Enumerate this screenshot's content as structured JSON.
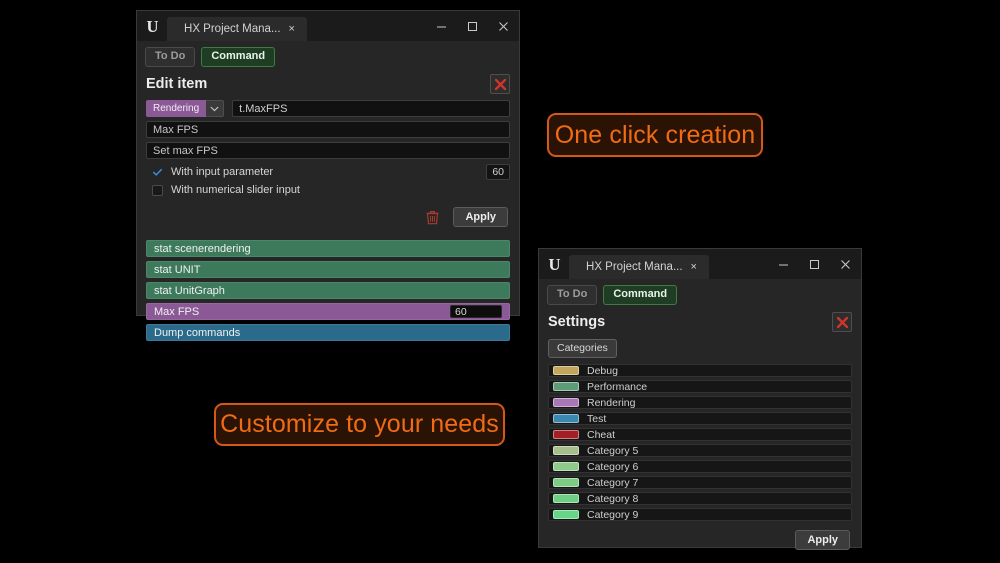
{
  "window_edit": {
    "name": "HX Project Manager - Edit item",
    "titlebar": {
      "tab_label": "HX Project Mana...",
      "tab_close": "×",
      "minimize": "minimize-icon",
      "maximize": "maximize-icon",
      "close": "close-icon"
    },
    "tabs": [
      {
        "label": "To Do",
        "active": false
      },
      {
        "label": "Command",
        "active": true
      }
    ],
    "section_title": "Edit item",
    "close_section": "close-red-icon",
    "category_badge": "Rendering",
    "category_caret": "chevron-down-icon",
    "command_value": "t.MaxFPS",
    "display_name": "Max FPS",
    "description": "Set max FPS",
    "options": [
      {
        "label": "With input parameter",
        "checked": true,
        "value": "60"
      },
      {
        "label": "With numerical slider input",
        "checked": false,
        "value": ""
      }
    ],
    "delete_icon": "trash-icon",
    "apply_label": "Apply",
    "commands": [
      {
        "label": "stat scenerendering",
        "color": "#3d7a5c",
        "value": null
      },
      {
        "label": "stat UNIT",
        "color": "#3d7a5c",
        "value": null
      },
      {
        "label": "stat UnitGraph",
        "color": "#3d7a5c",
        "value": null
      },
      {
        "label": "Max FPS",
        "color": "#8b5a96",
        "value": "60"
      },
      {
        "label": "Dump commands",
        "color": "#2a6b8c",
        "value": null
      }
    ]
  },
  "window_settings": {
    "name": "HX Project Manager - Settings",
    "titlebar": {
      "tab_label": "HX Project Mana...",
      "tab_close": "×",
      "minimize": "minimize-icon",
      "maximize": "maximize-icon",
      "close": "close-icon"
    },
    "tabs": [
      {
        "label": "To Do",
        "active": false
      },
      {
        "label": "Command",
        "active": true
      }
    ],
    "section_title": "Settings",
    "close_section": "close-red-icon",
    "categories_button": "Categories",
    "categories": [
      {
        "label": "Debug",
        "color": "#c2a65c"
      },
      {
        "label": "Performance",
        "color": "#5e9c77"
      },
      {
        "label": "Rendering",
        "color": "#a877b5"
      },
      {
        "label": "Test",
        "color": "#3a87b0"
      },
      {
        "label": "Cheat",
        "color": "#a31f26"
      },
      {
        "label": "Category 5",
        "color": "#a7bd8c"
      },
      {
        "label": "Category 6",
        "color": "#8ecb8a"
      },
      {
        "label": "Category 7",
        "color": "#7ecb86"
      },
      {
        "label": "Category 8",
        "color": "#6ecf84"
      },
      {
        "label": "Category 9",
        "color": "#67d488"
      }
    ],
    "apply_label": "Apply"
  },
  "callouts": [
    {
      "text": "One click creation"
    },
    {
      "text": "Customize to your needs"
    }
  ],
  "colors": {
    "accent_orange": "#ef6c14",
    "callout_border": "#d4581a",
    "callout_bg": "#2a1205",
    "tab_active_bg": "#1e3d22",
    "rendering_purple": "#8b5a96",
    "green": "#3d7a5c",
    "blue": "#2a6b8c",
    "red_close": "#d0352b"
  }
}
